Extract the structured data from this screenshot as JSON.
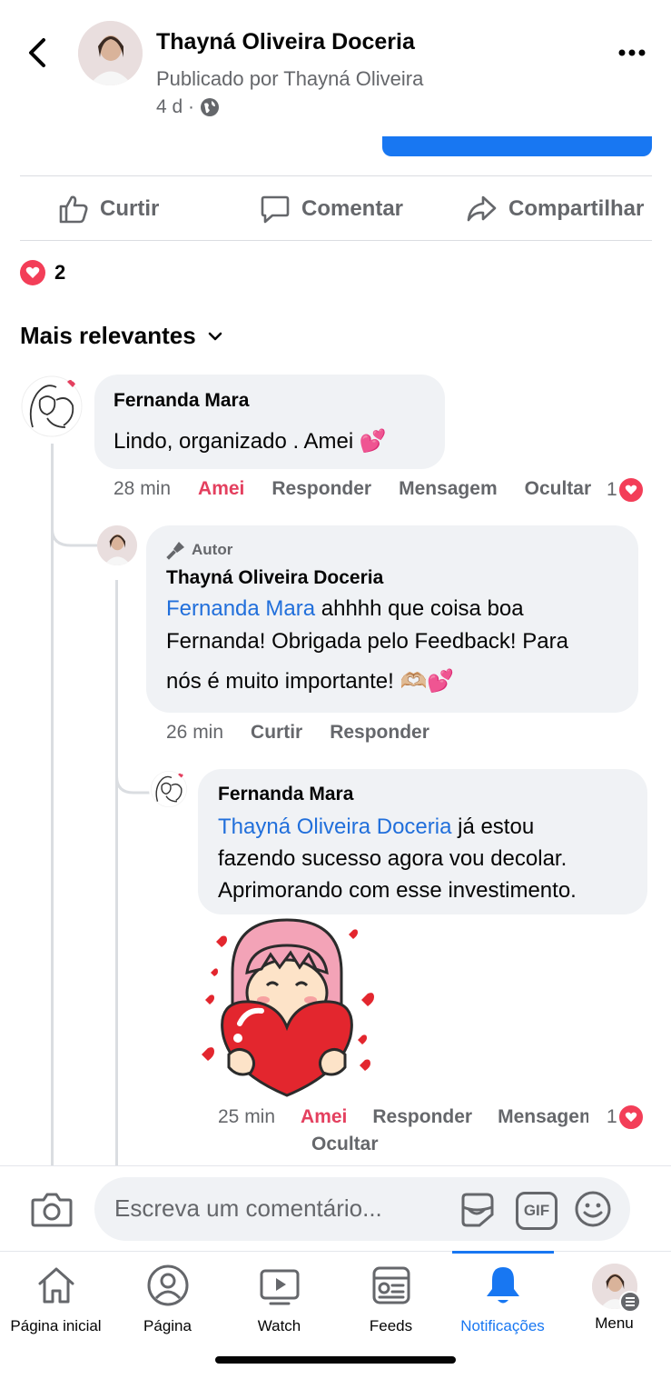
{
  "header": {
    "title": "Thayná Oliveira Doceria",
    "subtitle": "Publicado por Thayná Oliveira",
    "time": "4 d ·"
  },
  "actions": {
    "like": "Curtir",
    "comment": "Comentar",
    "share": "Compartilhar"
  },
  "reactions": {
    "count": "2"
  },
  "sort": {
    "label": "Mais relevantes"
  },
  "comments": [
    {
      "author": "Fernanda Mara",
      "text": "Lindo, organizado . Amei",
      "emoji": "💕",
      "time": "28 min",
      "actions": [
        "Amei",
        "Responder",
        "Mensagem",
        "Ocultar"
      ],
      "reaction_count": "1"
    },
    {
      "badge": "Autor",
      "author": "Thayná Oliveira Doceria",
      "mention": "Fernanda Mara",
      "text_line1": " ahhhh que coisa boa",
      "text_line2": "Fernanda! Obrigada pelo Feedback! Para",
      "text_line3": "nós é muito importante! ",
      "emoji": "🫶🏼💕",
      "time": "26 min",
      "actions": [
        "Curtir",
        "Responder"
      ]
    },
    {
      "author": "Fernanda Mara",
      "mention": "Thayná Oliveira Doceria",
      "text_line1": " já estou",
      "text_line2": "fazendo sucesso agora vou decolar.",
      "text_line3": "Aprimorando com esse investimento.",
      "time": "25 min",
      "actions": [
        "Amei",
        "Responder",
        "Mensagem",
        "Ocultar"
      ],
      "reaction_count": "1"
    }
  ],
  "composer": {
    "placeholder": "Escreva um comentário...",
    "gif": "GIF"
  },
  "nav": [
    {
      "label": "Página inicial",
      "icon": "home-icon"
    },
    {
      "label": "Página",
      "icon": "profile-icon"
    },
    {
      "label": "Watch",
      "icon": "watch-icon"
    },
    {
      "label": "Feeds",
      "icon": "feeds-icon"
    },
    {
      "label": "Notificações",
      "icon": "bell-icon",
      "active": true
    },
    {
      "label": "Menu",
      "icon": "avatar"
    }
  ],
  "colors": {
    "accent": "#1877f2",
    "love": "#f33e58",
    "amei_text": "#e4405f",
    "mention": "#216fdb",
    "bubble": "#f0f2f5"
  }
}
